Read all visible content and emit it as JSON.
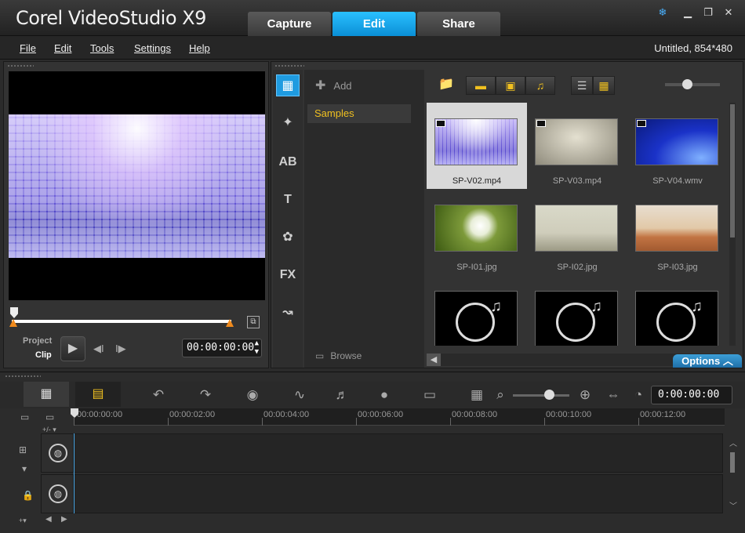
{
  "app": {
    "title_prefix": "Corel",
    "title_main": " VideoStudio",
    "title_suffix": " X9"
  },
  "tabs": [
    {
      "label": "Capture"
    },
    {
      "label": "Edit"
    },
    {
      "label": "Share"
    }
  ],
  "menu": [
    "File",
    "Edit",
    "Tools",
    "Settings",
    "Help"
  ],
  "project_info": "Untitled, 854*480",
  "player": {
    "mode_project": "Project",
    "mode_clip": "Clip",
    "timecode": "00:00:00:00"
  },
  "library": {
    "add_label": "Add",
    "folder": "Samples",
    "browse_label": "Browse",
    "options_label": "Options",
    "items": [
      {
        "name": "SP-V02.mp4",
        "type": "video",
        "selected": true
      },
      {
        "name": "SP-V03.mp4",
        "type": "video",
        "selected": false
      },
      {
        "name": "SP-V04.wmv",
        "type": "video",
        "selected": false
      },
      {
        "name": "SP-I01.jpg",
        "type": "image",
        "selected": false
      },
      {
        "name": "SP-I02.jpg",
        "type": "image",
        "selected": false
      },
      {
        "name": "SP-I03.jpg",
        "type": "image",
        "selected": false
      },
      {
        "name": "",
        "type": "audio",
        "selected": false
      },
      {
        "name": "",
        "type": "audio",
        "selected": false
      },
      {
        "name": "",
        "type": "audio",
        "selected": false
      }
    ]
  },
  "timeline": {
    "timecode": "0:00:00:00",
    "ruler": [
      "00:00:00:00",
      "00:00:02:00",
      "00:00:04:00",
      "00:00:06:00",
      "00:00:08:00",
      "00:00:10:00",
      "00:00:12:00"
    ]
  }
}
